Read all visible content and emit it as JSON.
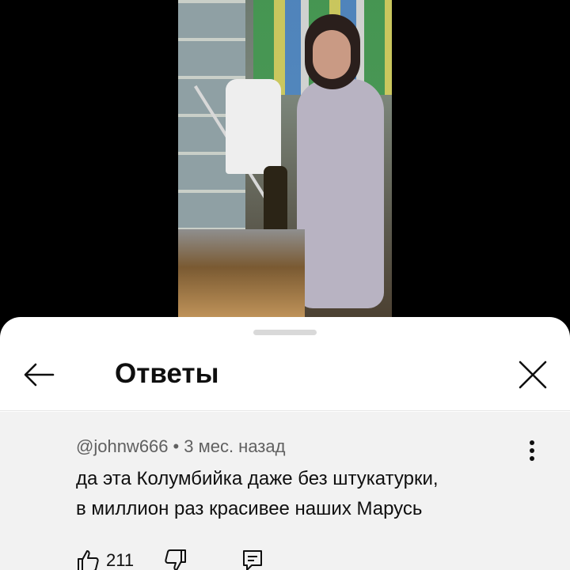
{
  "sheet": {
    "title": "Ответы"
  },
  "comment": {
    "author": "@johnw666",
    "separator": "•",
    "time": "3 мес. назад",
    "text_lines": [
      "да эта Колумбийка даже без штукатурки,",
      "в миллион раз красивее наших Марусь"
    ],
    "likes": "211"
  },
  "icons": {
    "back": "arrow-left-icon",
    "close": "close-icon",
    "more": "more-vertical-icon",
    "like": "thumb-up-icon",
    "dislike": "thumb-down-icon",
    "reply": "reply-comment-icon"
  },
  "colors": {
    "sheet_bg": "#ffffff",
    "comment_bg": "#f2f2f2",
    "text_primary": "#0f0f0f",
    "text_secondary": "#606060"
  }
}
